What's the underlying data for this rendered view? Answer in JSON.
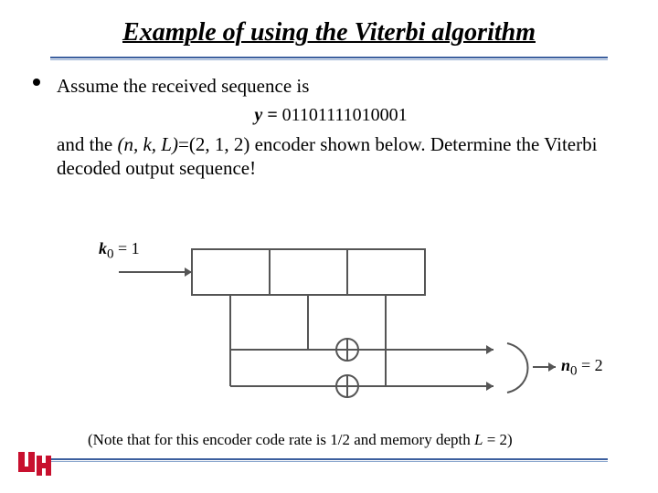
{
  "title": "Example of using the Viterbi algorithm",
  "bullet1": "Assume the received sequence is",
  "equation_prefix": "y = ",
  "equation_value": "01101111010001",
  "para2_pre": "and the ",
  "para2_nkL": "(n, k, L)",
  "para2_mid": "=(2, 1, 2) encoder shown below. Determine the Viterbi decoded output sequence!",
  "diagram": {
    "input_label_var": "k",
    "input_label_sub": "0",
    "input_label_val": " = 1",
    "output_label_var": "n",
    "output_label_sub": "0",
    "output_label_val": " = 2"
  },
  "note_pre": "(Note that for this encoder code rate is 1/2 and memory depth ",
  "note_L": "L",
  "note_post": " = 2)"
}
